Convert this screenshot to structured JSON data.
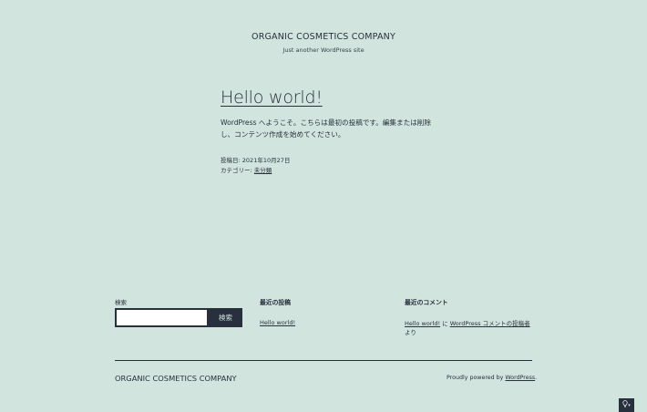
{
  "header": {
    "site_title": "ORGANIC COSMETICS COMPANY",
    "site_description": "Just another WordPress site"
  },
  "post": {
    "title": "Hello world!",
    "content": "WordPress へようこそ。こちらは最初の投稿です。編集または削除し、コンテンツ作成を始めてください。",
    "date_label": "投稿日:",
    "date_value": "2021年10月27日",
    "category_label": "カテゴリー:",
    "category_value": "未分類"
  },
  "widgets": {
    "search": {
      "label": "検索",
      "input_value": "",
      "button_label": "検索"
    },
    "recent_posts": {
      "title": "最近の投稿",
      "items": [
        "Hello world!"
      ]
    },
    "recent_comments": {
      "title": "最近のコメント",
      "post_link": "Hello world!",
      "connector": " に ",
      "author_link": "WordPress コメントの投稿者",
      "suffix": " より"
    }
  },
  "footer": {
    "site_title": "ORGANIC COSMETICS COMPANY",
    "credit_prefix": "Proudly powered by ",
    "credit_link": "WordPress",
    "credit_suffix": "."
  },
  "dark_mode_toggle": {
    "icon": "lightbulb-icon",
    "caret": "▾"
  },
  "colors": {
    "background": "#d1e4dd",
    "text": "#28303d"
  }
}
